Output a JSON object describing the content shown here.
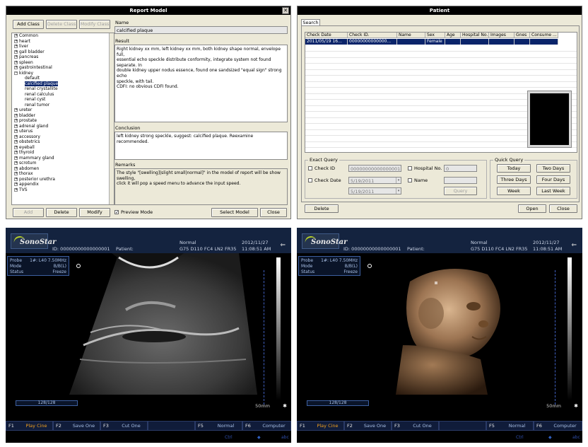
{
  "report": {
    "title": "Report Model",
    "buttons": {
      "add_class": "Add Class",
      "delete_class": "Delete Class",
      "modify_class": "Modify Class",
      "add": "Add",
      "delete": "Delete",
      "modify": "Modify",
      "select_model": "Select Model",
      "close": "Close"
    },
    "preview_mode": "Preview Mode",
    "tree": [
      {
        "label": "Common",
        "sign": "+"
      },
      {
        "label": "heart",
        "sign": "+"
      },
      {
        "label": "liver",
        "sign": "+"
      },
      {
        "label": "gall bladder",
        "sign": "+"
      },
      {
        "label": "pancreas",
        "sign": "+"
      },
      {
        "label": "spleen",
        "sign": "+"
      },
      {
        "label": "gastrointestinal",
        "sign": "+"
      },
      {
        "label": "kidney",
        "sign": "−"
      },
      {
        "label": "default",
        "child": true
      },
      {
        "label": "calcified plaque",
        "child": true,
        "selected": true
      },
      {
        "label": "renal crystallite",
        "child": true
      },
      {
        "label": "renal calculus",
        "child": true
      },
      {
        "label": "renal cyst",
        "child": true
      },
      {
        "label": "renal tumor",
        "child": true
      },
      {
        "label": "ureter",
        "sign": "+"
      },
      {
        "label": "bladder",
        "sign": "+"
      },
      {
        "label": "prostate",
        "sign": "+"
      },
      {
        "label": "adrenal gland",
        "sign": "+"
      },
      {
        "label": "uterus",
        "sign": "+"
      },
      {
        "label": "accessory",
        "sign": "+"
      },
      {
        "label": "obstetrics",
        "sign": "+"
      },
      {
        "label": "eyeball",
        "sign": "+"
      },
      {
        "label": "thyroid",
        "sign": "+"
      },
      {
        "label": "mammary gland",
        "sign": "+"
      },
      {
        "label": "scrotum",
        "sign": "+"
      },
      {
        "label": "abdomen",
        "sign": "+"
      },
      {
        "label": "thorax",
        "sign": "+"
      },
      {
        "label": "posterior urethra",
        "sign": "+"
      },
      {
        "label": "appendix",
        "sign": "+"
      },
      {
        "label": "TVS",
        "sign": "+"
      }
    ],
    "name_label": "Name",
    "name_value": "calcified plaque",
    "result_label": "Result",
    "result_lines": [
      "Right kidney xx mm, left kidney xx mm, both kidney shape normal, envelope full,",
      "essential echo speckle distribute conformity, integrate system not found separate. In",
      "double kidney upper nodus essence, found one sandsized \"equal sign\" strong echo",
      "speckle, with tail.",
      "CDFI: no obvious CDFI found."
    ],
    "conclusion_label": "Conclusion",
    "conclusion_text": "left kidney strong speckle, suggest: calcified plaque. Reexamine recommended.",
    "remarks_label": "Remarks",
    "remarks_lines": [
      "The style \"[swelling]|slight small|normal]\" in the model of report will be show swelling,",
      "click it will pop a speed menu to advance the input speed."
    ]
  },
  "patient": {
    "title": "Patient",
    "tab": "Search",
    "columns": [
      "Check Date",
      "Check ID.",
      "Name",
      "Sex",
      "Age",
      "Hospital No.",
      "Images",
      "Gnes",
      "Consume ..."
    ],
    "row": [
      "2011/05/19 16...",
      "00000000000000...",
      "",
      "Female",
      "",
      "",
      "",
      "",
      ""
    ],
    "exact_query": "Exact Query",
    "check_id": "Check ID",
    "check_id_value": "00000000000000001",
    "hospital_no": "Hospital No.",
    "hospital_no_value": "0",
    "check_date": "Check Date",
    "date_from": "5/19/2011",
    "date_to": "5/19/2011",
    "name": "Name",
    "query": "Query",
    "quick_query": "Quick Query",
    "quick": [
      "Today",
      "Two Days",
      "Three Days",
      "Four Days",
      "Week",
      "Last Week"
    ],
    "delete": "Delete",
    "open": "Open",
    "close": "Close"
  },
  "us_left": {
    "logo": "SonoStar",
    "id": "ID: 00000000000000001",
    "patient": "Patient:",
    "mode_top": "Normal",
    "params": "G75  D110  FC4  LN2  FR35",
    "date": "2012/11/27",
    "time": "11:08:51 AM",
    "usb": "⇐",
    "probe_label": "Probe",
    "probe_value": "1#: L40 7.50MHz",
    "mode_label": "Mode",
    "mode_value": "B/B(L)",
    "status_label": "Status",
    "status_value": "Freeze",
    "frame": "128/128",
    "scale": "50mm",
    "fkeys": [
      {
        "k": "F1",
        "n": "Play Cine",
        "orange": true
      },
      {
        "k": "F2",
        "n": "Save One"
      },
      {
        "k": "F3",
        "n": "Cut One"
      },
      {
        "k": "",
        "n": ""
      },
      {
        "k": "F5",
        "n": "Normal"
      },
      {
        "k": "F6",
        "n": "Computer"
      }
    ],
    "ctl": "Ctrl",
    "abc": "abc"
  },
  "us_right": {
    "logo": "SonoStar",
    "id": "ID: 00000000000000001",
    "patient": "Patient:",
    "mode_top": "Normal",
    "params": "G75  D110  FC4  LN2  FR35",
    "date": "2012/11/27",
    "time": "11:08:51 AM",
    "usb": "⇐",
    "probe_label": "Probe",
    "probe_value": "1#: L40 7.50MHz",
    "mode_label": "Mode",
    "mode_value": "B/B(L)",
    "status_label": "Status",
    "status_value": "Freeze",
    "frame": "128/128",
    "scale": "50mm",
    "fkeys": [
      {
        "k": "F1",
        "n": "Play Cine",
        "orange": true
      },
      {
        "k": "F2",
        "n": "Save One"
      },
      {
        "k": "F3",
        "n": "Cut One"
      },
      {
        "k": "",
        "n": ""
      },
      {
        "k": "F5",
        "n": "Normal"
      },
      {
        "k": "F6",
        "n": "Computer"
      }
    ],
    "ctl": "Ctrl",
    "abc": "abc"
  }
}
